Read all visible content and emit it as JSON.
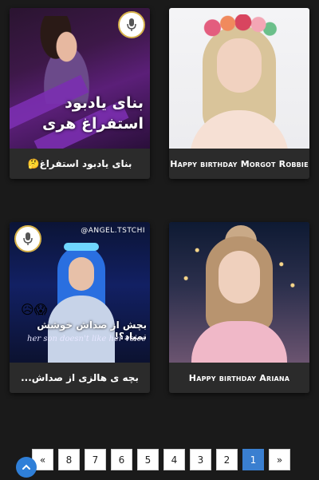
{
  "cards": [
    {
      "caption": "بنای یادبود استفراغ🤔",
      "overlay_line1": "بنای یادبود",
      "overlay_line2": "استفراغ هری",
      "has_logo": true,
      "icons": [
        "microphone-logo-icon"
      ]
    },
    {
      "caption": "Happy birthday Morgot Robbie",
      "has_logo": false
    },
    {
      "caption": "بچه ی هالزی از صداش...",
      "overlay_handle": "@ANGEL.TSTCHI",
      "overlay_subtitle": "بچش از صداش خوشش نمیاد؟!",
      "overlay_subtitle_en": "her son doesn't like her voice",
      "overlay_emojis": "😥😱",
      "has_logo": true
    },
    {
      "caption": "Happy birthday Ariana",
      "has_logo": false
    }
  ],
  "pagination": {
    "items": [
      "1",
      "2",
      "3",
      "4",
      "5",
      "6",
      "7",
      "8",
      "«"
    ],
    "next": "»",
    "active": "1"
  },
  "colors": {
    "background": "#1a1a1a",
    "card": "#2b2b2b",
    "active_page": "#3a7fd0",
    "scroll_button": "#2f7fd8"
  },
  "icons": {
    "scroll_top": "chevron-up-icon",
    "logo": "microphone-logo-icon"
  }
}
